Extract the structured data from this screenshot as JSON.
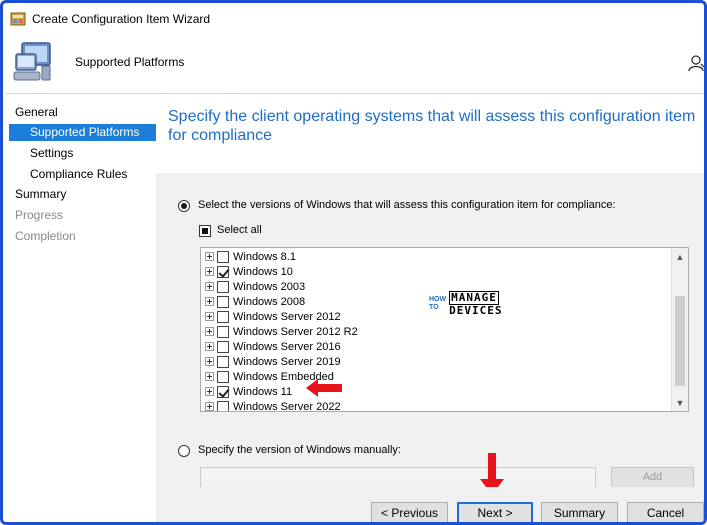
{
  "window": {
    "title": "Create Configuration Item Wizard"
  },
  "header": {
    "title": "Supported Platforms"
  },
  "nav": {
    "items": [
      {
        "label": "General",
        "state": "normal"
      },
      {
        "label": "Supported Platforms",
        "state": "selected"
      },
      {
        "label": "Settings",
        "state": "normal"
      },
      {
        "label": "Compliance Rules",
        "state": "normal"
      },
      {
        "label": "Summary",
        "state": "normal"
      },
      {
        "label": "Progress",
        "state": "disabled"
      },
      {
        "label": "Completion",
        "state": "disabled"
      }
    ]
  },
  "content": {
    "heading": "Specify the client operating systems that will assess this configuration item for compliance",
    "radio_versions_label": "Select the versions of Windows that will assess this configuration item for compliance:",
    "select_all_label": "Select all",
    "tree": [
      {
        "label": "Windows 8.1",
        "checked": false
      },
      {
        "label": "Windows 10",
        "checked": true
      },
      {
        "label": "Windows 2003",
        "checked": false
      },
      {
        "label": "Windows 2008",
        "checked": false
      },
      {
        "label": "Windows Server 2012",
        "checked": false
      },
      {
        "label": "Windows Server 2012 R2",
        "checked": false
      },
      {
        "label": "Windows Server 2016",
        "checked": false
      },
      {
        "label": "Windows Server 2019",
        "checked": false
      },
      {
        "label": "Windows Embedded",
        "checked": false
      },
      {
        "label": "Windows 11",
        "checked": true
      },
      {
        "label": "Windows Server 2022",
        "checked": false
      }
    ],
    "radio_manual_label": "Specify the version of Windows manually:",
    "add_label": "Add"
  },
  "watermark": {
    "how": "HOW",
    "to": "TO",
    "manage": "MANAGE",
    "devices": "DEVICES"
  },
  "buttons": {
    "previous": "< Previous",
    "next": "Next >",
    "summary": "Summary",
    "cancel": "Cancel"
  },
  "colors": {
    "accent": "#1c7ed8",
    "heading": "#1f6dc4",
    "annotation": "#e8141c",
    "frame": "#1a4fd6"
  }
}
